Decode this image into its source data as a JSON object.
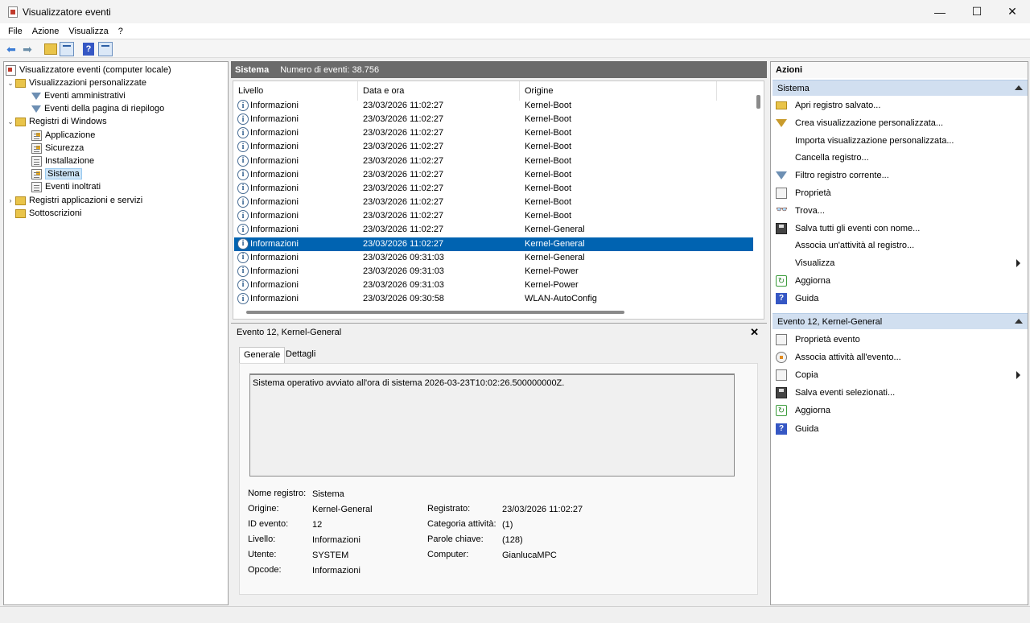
{
  "window": {
    "title": "Visualizzatore eventi",
    "minimize": "—",
    "maximize": "☐",
    "close": "✕"
  },
  "menu": [
    "File",
    "Azione",
    "Visualizza",
    "?"
  ],
  "tree": {
    "root": "Visualizzatore eventi (computer locale)",
    "custom_views": "Visualizzazioni personalizzate",
    "admin_events": "Eventi amministrativi",
    "summary_events": "Eventi della pagina di riepilogo",
    "windows_logs": "Registri di Windows",
    "application": "Applicazione",
    "security": "Sicurezza",
    "setup": "Installazione",
    "system": "Sistema",
    "forwarded": "Eventi inoltrati",
    "app_services": "Registri applicazioni e servizi",
    "subscriptions": "Sottoscrizioni"
  },
  "center": {
    "log_name": "Sistema",
    "event_count": "Numero di eventi: 38.756",
    "columns": [
      "Livello",
      "Data e ora",
      "Origine"
    ],
    "rows": [
      {
        "level": "Informazioni",
        "date": "23/03/2026 11:02:27",
        "source": "Kernel-Boot"
      },
      {
        "level": "Informazioni",
        "date": "23/03/2026 11:02:27",
        "source": "Kernel-Boot"
      },
      {
        "level": "Informazioni",
        "date": "23/03/2026 11:02:27",
        "source": "Kernel-Boot"
      },
      {
        "level": "Informazioni",
        "date": "23/03/2026 11:02:27",
        "source": "Kernel-Boot"
      },
      {
        "level": "Informazioni",
        "date": "23/03/2026 11:02:27",
        "source": "Kernel-Boot"
      },
      {
        "level": "Informazioni",
        "date": "23/03/2026 11:02:27",
        "source": "Kernel-Boot"
      },
      {
        "level": "Informazioni",
        "date": "23/03/2026 11:02:27",
        "source": "Kernel-Boot"
      },
      {
        "level": "Informazioni",
        "date": "23/03/2026 11:02:27",
        "source": "Kernel-Boot"
      },
      {
        "level": "Informazioni",
        "date": "23/03/2026 11:02:27",
        "source": "Kernel-Boot"
      },
      {
        "level": "Informazioni",
        "date": "23/03/2026 11:02:27",
        "source": "Kernel-General"
      },
      {
        "level": "Informazioni",
        "date": "23/03/2026 11:02:27",
        "source": "Kernel-General",
        "selected": true
      },
      {
        "level": "Informazioni",
        "date": "23/03/2026 09:31:03",
        "source": "Kernel-General"
      },
      {
        "level": "Informazioni",
        "date": "23/03/2026 09:31:03",
        "source": "Kernel-Power"
      },
      {
        "level": "Informazioni",
        "date": "23/03/2026 09:31:03",
        "source": "Kernel-Power"
      },
      {
        "level": "Informazioni",
        "date": "23/03/2026 09:30:58",
        "source": "WLAN-AutoConfig"
      }
    ]
  },
  "detail": {
    "title": "Evento 12, Kernel-General",
    "tab_general": "Generale",
    "tab_details": "Dettagli",
    "message": "Sistema operativo avviato all'ora di sistema 2026-03-23T10:02:26.500000000Z.",
    "labels": {
      "log_name": "Nome registro:",
      "source": "Origine:",
      "event_id": "ID evento:",
      "level": "Livello:",
      "user": "Utente:",
      "opcode": "Opcode:",
      "logged": "Registrato:",
      "task_category": "Categoria attività:",
      "keywords": "Parole chiave:",
      "computer": "Computer:"
    },
    "values": {
      "log_name": "Sistema",
      "source": "Kernel-General",
      "event_id": "12",
      "level": "Informazioni",
      "user": "SYSTEM",
      "opcode": "Informazioni",
      "logged": "23/03/2026 11:02:27",
      "task_category": "(1)",
      "keywords": "(128)",
      "computer": "GianlucaMPC"
    }
  },
  "actions": {
    "header": "Azioni",
    "section1": "Sistema",
    "items1": [
      {
        "label": "Apri registro salvato...",
        "icon": "open-log-icon"
      },
      {
        "label": "Crea visualizzazione personalizzata...",
        "icon": "create-view-icon"
      },
      {
        "label": "Importa visualizzazione personalizzata...",
        "icon": "none"
      },
      {
        "label": "Cancella registro...",
        "icon": "none"
      },
      {
        "label": "Filtro registro corrente...",
        "icon": "filter-icon"
      },
      {
        "label": "Proprietà",
        "icon": "properties-icon"
      },
      {
        "label": "Trova...",
        "icon": "find-icon"
      },
      {
        "label": "Salva tutti gli eventi con nome...",
        "icon": "save-icon"
      },
      {
        "label": "Associa un'attività al registro...",
        "icon": "none"
      },
      {
        "label": "Visualizza",
        "icon": "none",
        "submenu": true
      },
      {
        "label": "Aggiorna",
        "icon": "refresh-icon"
      },
      {
        "label": "Guida",
        "icon": "help-icon"
      }
    ],
    "section2": "Evento 12, Kernel-General",
    "items2": [
      {
        "label": "Proprietà evento",
        "icon": "event-properties-icon"
      },
      {
        "label": "Associa attività all'evento...",
        "icon": "attach-task-icon"
      },
      {
        "label": "Copia",
        "icon": "copy-icon",
        "submenu": true
      },
      {
        "label": "Salva eventi selezionati...",
        "icon": "save-icon"
      },
      {
        "label": "Aggiorna",
        "icon": "refresh-icon"
      },
      {
        "label": "Guida",
        "icon": "help-icon"
      }
    ]
  }
}
